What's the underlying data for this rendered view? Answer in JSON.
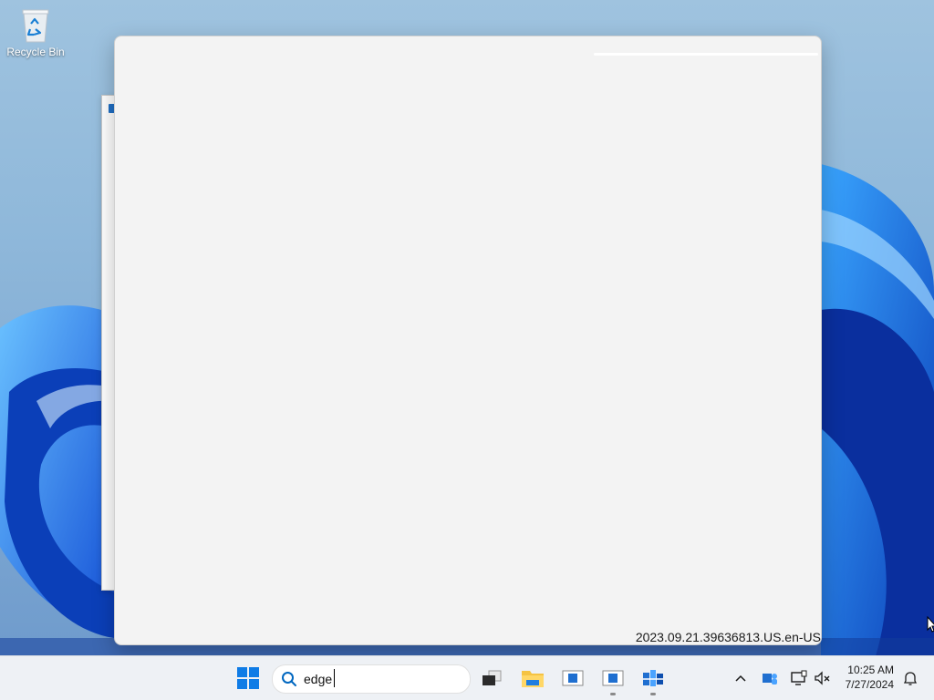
{
  "desktop": {
    "icons": [
      {
        "label": "Recycle Bin",
        "icon": "recycle-bin-icon"
      }
    ]
  },
  "main_window": {
    "build_text": "2023.09.21.39636813.US.en-US"
  },
  "taskbar": {
    "start_icon": "windows-start-icon",
    "search": {
      "value": "edge",
      "icon": "search-icon"
    },
    "apps": [
      {
        "icon": "task-view-icon",
        "running": false
      },
      {
        "icon": "file-explorer-icon",
        "running": false
      },
      {
        "icon": "app-window-icon",
        "running": false
      },
      {
        "icon": "app-window-active-icon",
        "running": true
      },
      {
        "icon": "azure-data-studio-icon",
        "running": true
      }
    ],
    "tray": {
      "time": "10:25 AM",
      "date": "7/27/2024",
      "icons": [
        "chevron-up-icon",
        "teams-icon",
        "network-icon",
        "volume-muted-icon",
        "notification-icon"
      ]
    }
  },
  "colors": {
    "accent": "#0078d4",
    "taskbar_bg": "#eef1f5",
    "window_bg": "#f3f3f3"
  }
}
